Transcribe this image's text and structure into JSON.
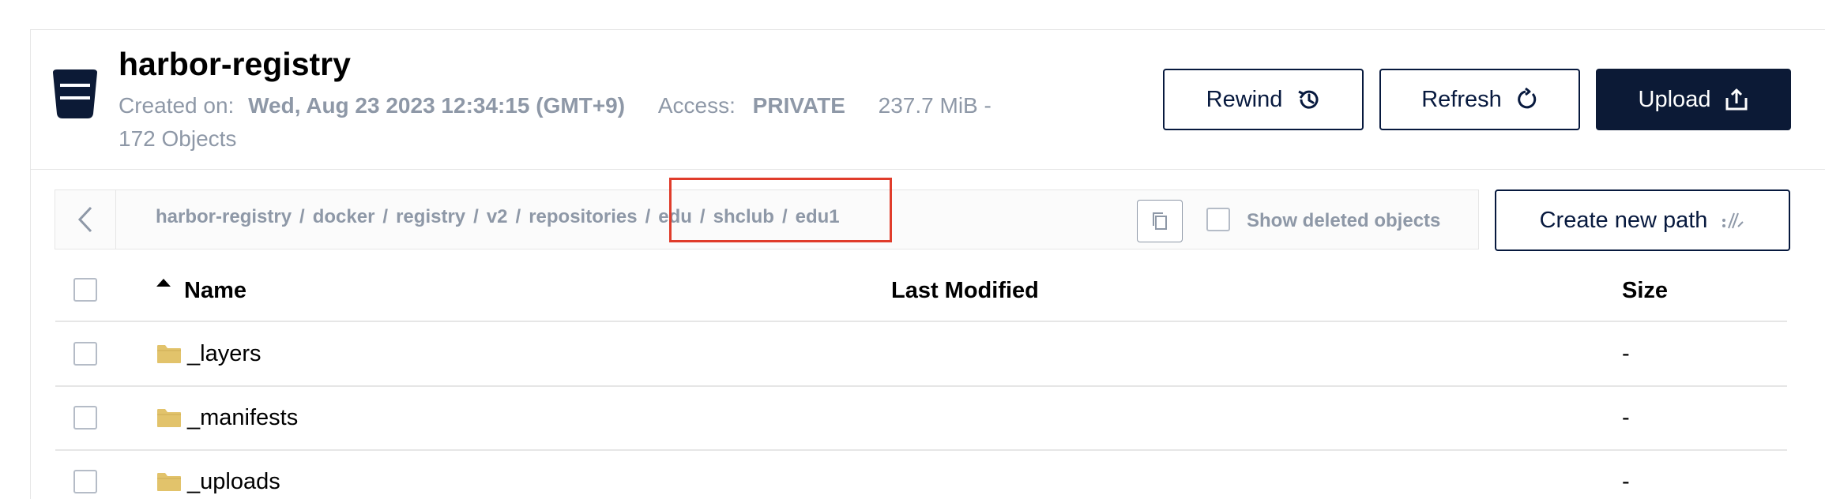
{
  "bucket": {
    "name": "harbor-registry",
    "created_label": "Created on:",
    "created_value": "Wed, Aug 23 2023 12:34:15 (GMT+9)",
    "access_label": "Access:",
    "access_value": "PRIVATE",
    "size_summary": "237.7 MiB -",
    "objects_summary": "172 Objects"
  },
  "actions": {
    "rewind_label": "Rewind",
    "refresh_label": "Refresh",
    "upload_label": "Upload",
    "create_path_label": "Create new path"
  },
  "breadcrumb": {
    "separator": "/",
    "segments": [
      "harbor-registry",
      "docker",
      "registry",
      "v2",
      "repositories",
      "edu",
      "shclub",
      "edu1"
    ]
  },
  "show_deleted_label": "Show deleted objects",
  "table": {
    "columns": {
      "name": "Name",
      "last_modified": "Last Modified",
      "size": "Size"
    },
    "rows": [
      {
        "name": "_layers",
        "last_modified": "",
        "size": "-"
      },
      {
        "name": "_manifests",
        "last_modified": "",
        "size": "-"
      },
      {
        "name": "_uploads",
        "last_modified": "",
        "size": "-"
      }
    ]
  },
  "colors": {
    "navy": "#0c1a36",
    "muted_text": "#8e98a7",
    "folder": "#e2c36b",
    "highlight": "#e03c2b"
  },
  "icons": [
    "bucket-icon",
    "rewind-icon",
    "refresh-icon",
    "upload-icon",
    "back-chevron-icon",
    "copy-icon",
    "new-path-icon",
    "folder-icon",
    "sort-up-icon"
  ]
}
